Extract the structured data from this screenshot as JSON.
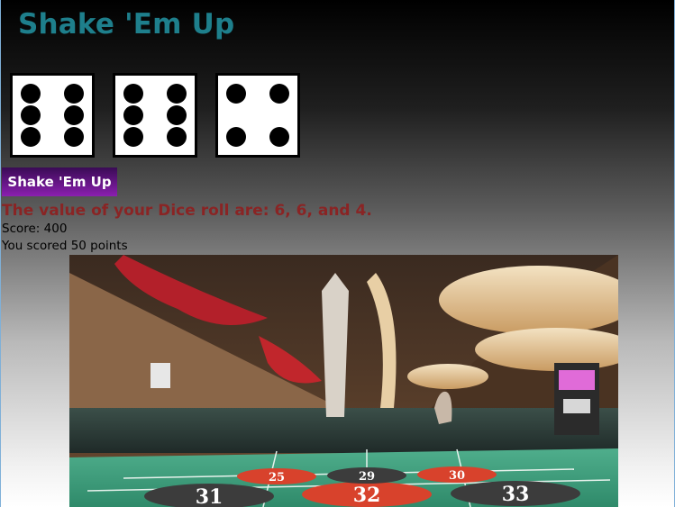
{
  "app": {
    "title": "Shake 'Em Up"
  },
  "dice": [
    6,
    6,
    4
  ],
  "button": {
    "label": "Shake 'Em Up"
  },
  "result": {
    "text": "The value of your Dice roll are: 6, 6, and 4."
  },
  "score": {
    "text": "Score: 400"
  },
  "points": {
    "text": "You scored 50 points"
  },
  "roulette": {
    "numbers": [
      "31",
      "32",
      "33",
      "25",
      "29",
      "30"
    ]
  },
  "colors": {
    "title": "#1e7f8c",
    "result": "#8a2424",
    "button_top": "#3a0b55",
    "button_bottom": "#8b1fb0"
  }
}
